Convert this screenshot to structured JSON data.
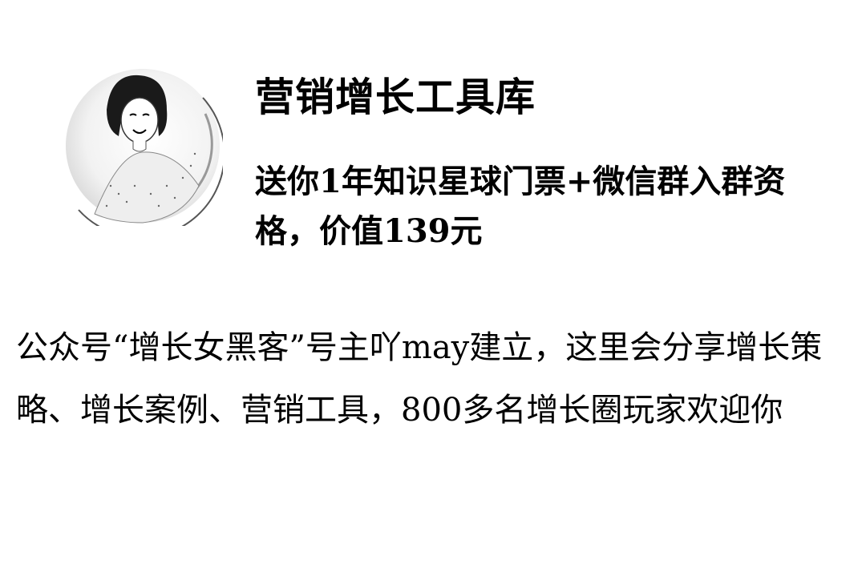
{
  "avatar": {
    "icon": "woman-portrait-icon"
  },
  "header": {
    "title": "营销增长工具库",
    "subtitle": "送你1年知识星球门票+微信群入群资格，价值139元"
  },
  "main": {
    "description": "公众号“增长女黑客”号主吖may建立，这里会分享增长策略、增长案例、营销工具，800多名增长圈玩家欢迎你"
  }
}
